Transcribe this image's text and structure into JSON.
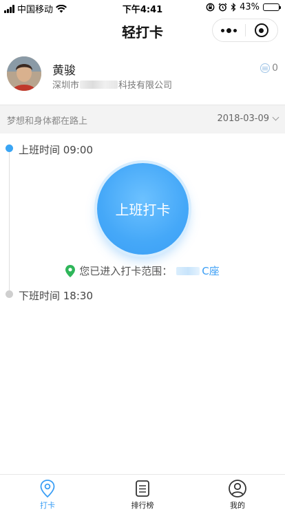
{
  "status_bar": {
    "carrier": "中国移动",
    "time": "下午4:41",
    "battery": "43%",
    "battery_level": 0.43
  },
  "header": {
    "title": "轻打卡"
  },
  "profile": {
    "name": "黄骏",
    "company_prefix": "深圳市",
    "company_suffix": "科技有限公司",
    "points": "0"
  },
  "motto_bar": {
    "motto": "梦想和身体都在路上",
    "date": "2018-03-09"
  },
  "timeline": {
    "start_label": "上班时间 09:00",
    "end_label": "下班时间 18:30"
  },
  "punch": {
    "button_label": "上班打卡",
    "range_text": "您已进入打卡范围：",
    "range_location": "C座"
  },
  "colors": {
    "accent": "#3a9ef5",
    "location_pin": "#2fb65a"
  },
  "tabbar": {
    "items": [
      {
        "label": "打卡",
        "icon": "location-pin-icon",
        "active": true
      },
      {
        "label": "排行榜",
        "icon": "list-board-icon",
        "active": false
      },
      {
        "label": "我的",
        "icon": "user-profile-icon",
        "active": false
      }
    ]
  }
}
